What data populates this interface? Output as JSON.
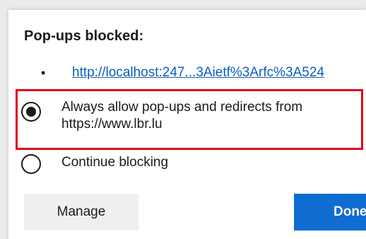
{
  "popup": {
    "title": "Pop-ups blocked:",
    "bullet": "•",
    "blocked_link": "http://localhost:247...3Aietf%3Arfc%3A524",
    "options": [
      {
        "label": "Always allow pop-ups and redirects from https://www.lbr.lu",
        "selected": true
      },
      {
        "label": "Continue blocking",
        "selected": false
      }
    ],
    "manage_label": "Manage",
    "done_label": "Done"
  },
  "colors": {
    "accent": "#0f6cd1",
    "link": "#0a5fbf",
    "highlight_border": "#e0001b"
  },
  "icons": {
    "selected_radio": "radio-checked-icon",
    "unselected_radio": "radio-unchecked-icon"
  }
}
